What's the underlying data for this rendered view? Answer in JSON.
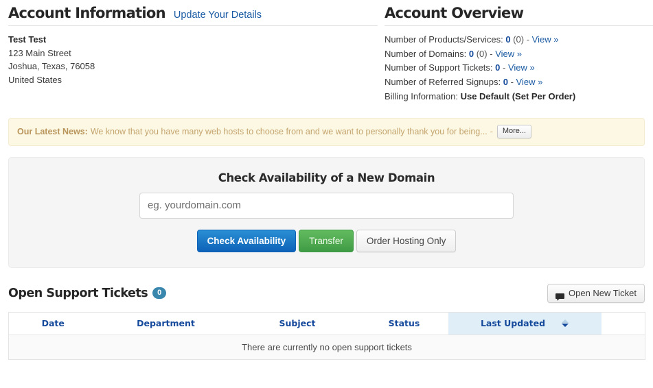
{
  "account_information": {
    "title": "Account Information",
    "update_link": "Update Your Details",
    "name": "Test Test",
    "address_line1": "123 Main Street",
    "address_line2": "Joshua, Texas, 76058",
    "country": "United States"
  },
  "account_overview": {
    "title": "Account Overview",
    "rows": [
      {
        "label": "Number of Products/Services:",
        "count": "0",
        "paren": "(0)",
        "dash": "-",
        "link": "View »"
      },
      {
        "label": "Number of Domains:",
        "count": "0",
        "paren": "(0)",
        "dash": "-",
        "link": "View »"
      },
      {
        "label": "Number of Support Tickets:",
        "count": "0",
        "paren": "",
        "dash": "-",
        "link": "View »"
      },
      {
        "label": "Number of Referred Signups:",
        "count": "0",
        "paren": "",
        "dash": "-",
        "link": "View »"
      }
    ],
    "billing_label": "Billing Information:",
    "billing_value": "Use Default (Set Per Order)"
  },
  "news": {
    "label": "Our Latest News:",
    "text": "We know that you have many web hosts to choose from and we want to personally thank you for being...",
    "separator": "-",
    "more_button": "More..."
  },
  "domain_search": {
    "title": "Check Availability of a New Domain",
    "input_value": "",
    "input_placeholder": "eg. yourdomain.com",
    "check_button": "Check Availability",
    "transfer_button": "Transfer",
    "hosting_button": "Order Hosting Only"
  },
  "tickets": {
    "title": "Open Support Tickets",
    "count_badge": "0",
    "new_ticket_button": "Open New Ticket",
    "new_ticket_icon": "comment-icon",
    "columns": [
      "Date",
      "Department",
      "Subject",
      "Status",
      "Last Updated"
    ],
    "sorted_column": "Last Updated",
    "sort_direction": "descending",
    "empty_message": "There are currently no open support tickets"
  },
  "colors": {
    "link_blue": "#1b5ba3",
    "header_blue": "#15499b",
    "badge_blue": "#3a87ad",
    "primary_button": "#0d62b8",
    "success_button": "#3f9b45",
    "news_background": "#fcf8e3",
    "news_text": "#c4a46e",
    "sorted_column_background": "#dfeef7",
    "panel_background": "#f5f5f5"
  }
}
